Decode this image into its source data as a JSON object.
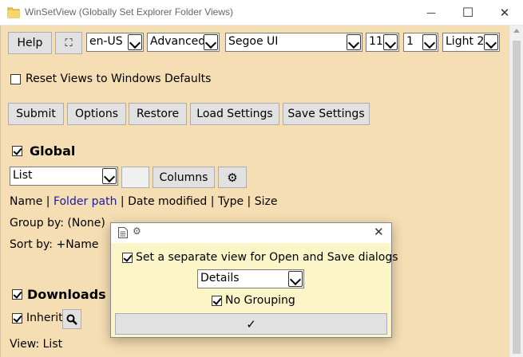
{
  "window": {
    "title": "WinSetView (Globally Set Explorer Folder Views)",
    "minimize_glyph": "—",
    "maximize_glyph": "☐",
    "close_glyph": "✕"
  },
  "toolbar": {
    "help_label": "Help",
    "fullscreen_glyph": "⛶",
    "language": "en-US",
    "mode": "Advanced",
    "font": "Segoe UI",
    "font_size": "11",
    "spacing": "1",
    "theme": "Light 2"
  },
  "reset_label": "Reset Views to Windows Defaults",
  "actions": {
    "submit": "Submit",
    "options": "Options",
    "restore": "Restore",
    "load_settings": "Load Settings",
    "save_settings": "Save Settings"
  },
  "global": {
    "heading": "Global",
    "view": "List",
    "columns_label": "Columns",
    "gear_glyph": "⚙",
    "columns": {
      "name": "Name",
      "sep1": " | ",
      "folder_path": "Folder path",
      "sep2": " | ",
      "date_modified": "Date modified",
      "sep3": " | ",
      "type": "Type",
      "sep4": " | ",
      "size": "Size"
    },
    "group_by": "Group by: (None)",
    "sort_by": "Sort by: +Name"
  },
  "downloads": {
    "heading": "Downloads",
    "inherit_label": "Inherit",
    "view": "View: List"
  },
  "dialog": {
    "gear_glyph": "⚙",
    "close_glyph": "✕",
    "separate_view_label": "Set a separate view for Open and Save dialogs",
    "view": "Details",
    "no_grouping_label": "No Grouping",
    "ok_glyph": "✓"
  }
}
